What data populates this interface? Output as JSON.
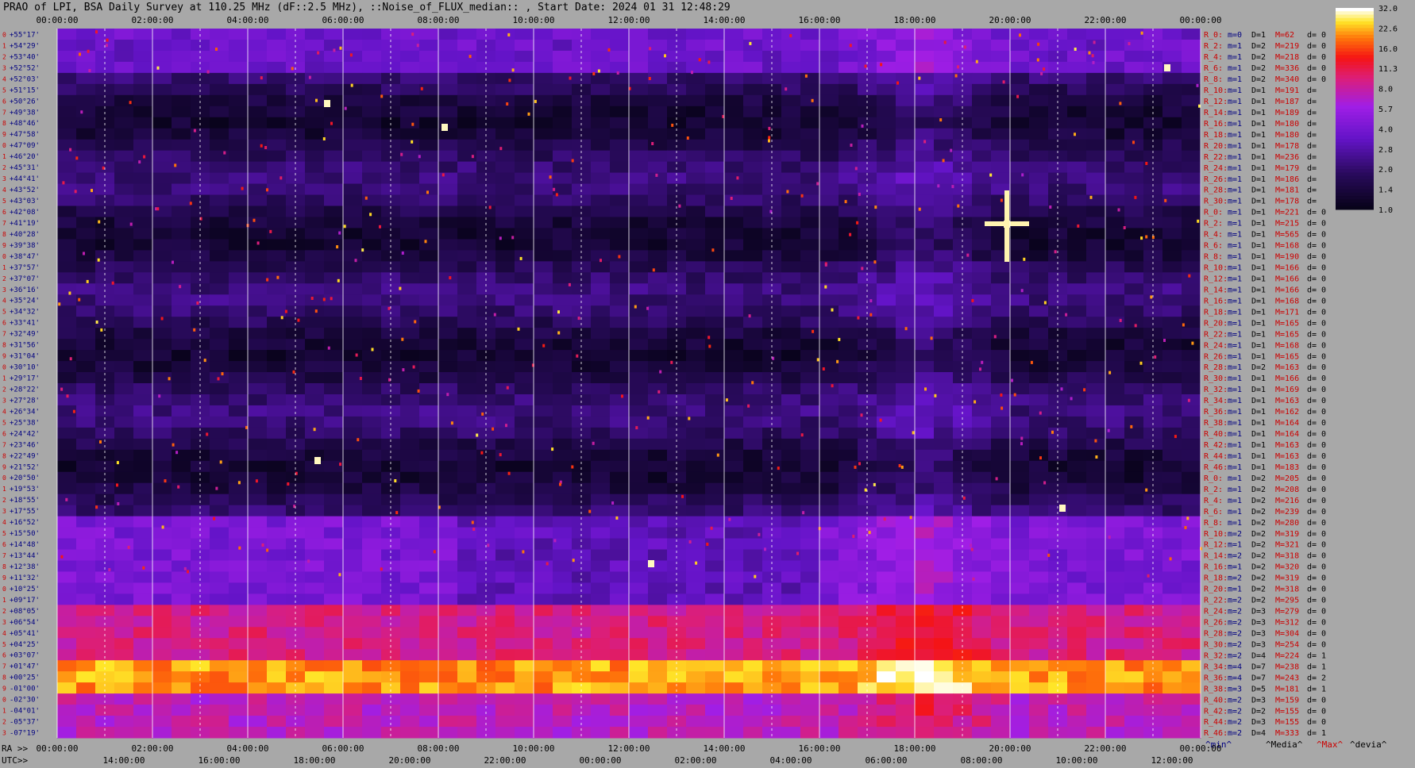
{
  "title": "PRAO of LPI, BSA Daily Survey at 110.25 MHz (dF::2.5 MHz), ::Noise_of_FLUX_median:: , Start Date: 2024 01 31 12:48:29",
  "colors": {
    "background": "#a8a8a8",
    "label_red": "#cc0000",
    "label_blue": "#000080"
  },
  "chart_data": {
    "type": "heatmap",
    "colormap": "black-purple-red-yellow-white",
    "top_axis_labels": [
      "00:00:00",
      "02:00:00",
      "04:00:00",
      "06:00:00",
      "08:00:00",
      "10:00:00",
      "12:00:00",
      "14:00:00",
      "16:00:00",
      "18:00:00",
      "20:00:00",
      "22:00:00",
      "00:00:00"
    ],
    "bottom_ra_prefix": "RA >>",
    "bottom_ra_labels": [
      "00:00:00",
      "02:00:00",
      "04:00:00",
      "06:00:00",
      "08:00:00",
      "10:00:00",
      "12:00:00",
      "14:00:00",
      "16:00:00",
      "18:00:00",
      "20:00:00",
      "22:00:00",
      "00:00:00"
    ],
    "bottom_utc_prefix": "UTC>>",
    "bottom_utc_labels": [
      "14:00:00",
      "16:00:00",
      "18:00:00",
      "20:00:00",
      "22:00:00",
      "00:00:00",
      "02:00:00",
      "04:00:00",
      "06:00:00",
      "08:00:00",
      "10:00:00",
      "12:00:00"
    ],
    "declination_labels": [
      "+55°17'",
      "+54°29'",
      "+53°40'",
      "+52°52'",
      "+52°03'",
      "+51°15'",
      "+50°26'",
      "+49°38'",
      "+48°46'",
      "+47°58'",
      "+47°09'",
      "+46°20'",
      "+45°31'",
      "+44°41'",
      "+43°52'",
      "+43°03'",
      "+42°08'",
      "+41°19'",
      "+40°28'",
      "+39°38'",
      "+38°47'",
      "+37°57'",
      "+37°07'",
      "+36°16'",
      "+35°24'",
      "+34°32'",
      "+33°41'",
      "+32°49'",
      "+31°56'",
      "+31°04'",
      "+30°10'",
      "+29°17'",
      "+28°22'",
      "+27°28'",
      "+26°34'",
      "+25°38'",
      "+24°42'",
      "+23°46'",
      "+22°49'",
      "+21°52'",
      "+20°50'",
      "+19°53'",
      "+18°55'",
      "+17°55'",
      "+16°52'",
      "+15°50'",
      "+14°48'",
      "+13°44'",
      "+12°38'",
      "+11°32'",
      "+10°25'",
      "+09°17'",
      "+08°05'",
      "+06°54'",
      "+05°41'",
      "+04°25'",
      "+03°07'",
      "+01°47'",
      "+00°25'",
      "-01°00'",
      "-02°30'",
      "-04°01'",
      "-05°37'",
      "-07°19'"
    ],
    "colorbar_ticks": [
      "32.0",
      "22.6",
      "16.0",
      "11.3",
      "8.0",
      "5.7",
      "4.0",
      "2.8",
      "2.0",
      "1.4",
      "1.0"
    ],
    "right_stats": [
      {
        "r": "R_0:",
        "m": "m=0",
        "d": "D=1",
        "M": "M=62",
        "dd": "d= 0"
      },
      {
        "r": "R_2:",
        "m": "m=1",
        "d": "D=2",
        "M": "M=219",
        "dd": "d= 0"
      },
      {
        "r": "R_4:",
        "m": "m=1",
        "d": "D=2",
        "M": "M=218",
        "dd": "d= 0"
      },
      {
        "r": "R_6:",
        "m": "m=1",
        "d": "D=2",
        "M": "M=336",
        "dd": "d= 0"
      },
      {
        "r": "R_8:",
        "m": "m=1",
        "d": "D=2",
        "M": "M=340",
        "dd": "d= 0"
      },
      {
        "r": "R_10:",
        "m": "m=1",
        "d": "D=1",
        "M": "M=191",
        "dd": "d="
      },
      {
        "r": "R_12:",
        "m": "m=1",
        "d": "D=1",
        "M": "M=187",
        "dd": "d="
      },
      {
        "r": "R_14:",
        "m": "m=1",
        "d": "D=1",
        "M": "M=189",
        "dd": "d="
      },
      {
        "r": "R_16:",
        "m": "m=1",
        "d": "D=1",
        "M": "M=180",
        "dd": "d="
      },
      {
        "r": "R_18:",
        "m": "m=1",
        "d": "D=1",
        "M": "M=180",
        "dd": "d="
      },
      {
        "r": "R_20:",
        "m": "m=1",
        "d": "D=1",
        "M": "M=178",
        "dd": "d="
      },
      {
        "r": "R_22:",
        "m": "m=1",
        "d": "D=1",
        "M": "M=236",
        "dd": "d="
      },
      {
        "r": "R_24:",
        "m": "m=1",
        "d": "D=1",
        "M": "M=179",
        "dd": "d="
      },
      {
        "r": "R_26:",
        "m": "m=1",
        "d": "D=1",
        "M": "M=186",
        "dd": "d="
      },
      {
        "r": "R_28:",
        "m": "m=1",
        "d": "D=1",
        "M": "M=181",
        "dd": "d="
      },
      {
        "r": "R_30:",
        "m": "m=1",
        "d": "D=1",
        "M": "M=178",
        "dd": "d="
      },
      {
        "r": "R_0:",
        "m": "m=1",
        "d": "D=1",
        "M": "M=221",
        "dd": "d= 0"
      },
      {
        "r": "R_2:",
        "m": "m=1",
        "d": "D=1",
        "M": "M=215",
        "dd": "d= 0"
      },
      {
        "r": "R_4:",
        "m": "m=1",
        "d": "D=1",
        "M": "M=565",
        "dd": "d= 0"
      },
      {
        "r": "R_6:",
        "m": "m=1",
        "d": "D=1",
        "M": "M=168",
        "dd": "d= 0"
      },
      {
        "r": "R_8:",
        "m": "m=1",
        "d": "D=1",
        "M": "M=190",
        "dd": "d= 0"
      },
      {
        "r": "R_10:",
        "m": "m=1",
        "d": "D=1",
        "M": "M=166",
        "dd": "d= 0"
      },
      {
        "r": "R_12:",
        "m": "m=1",
        "d": "D=1",
        "M": "M=166",
        "dd": "d= 0"
      },
      {
        "r": "R_14:",
        "m": "m=1",
        "d": "D=1",
        "M": "M=166",
        "dd": "d= 0"
      },
      {
        "r": "R_16:",
        "m": "m=1",
        "d": "D=1",
        "M": "M=168",
        "dd": "d= 0"
      },
      {
        "r": "R_18:",
        "m": "m=1",
        "d": "D=1",
        "M": "M=171",
        "dd": "d= 0"
      },
      {
        "r": "R_20:",
        "m": "m=1",
        "d": "D=1",
        "M": "M=165",
        "dd": "d= 0"
      },
      {
        "r": "R_22:",
        "m": "m=1",
        "d": "D=1",
        "M": "M=165",
        "dd": "d= 0"
      },
      {
        "r": "R_24:",
        "m": "m=1",
        "d": "D=1",
        "M": "M=168",
        "dd": "d= 0"
      },
      {
        "r": "R_26:",
        "m": "m=1",
        "d": "D=1",
        "M": "M=165",
        "dd": "d= 0"
      },
      {
        "r": "R_28:",
        "m": "m=1",
        "d": "D=2",
        "M": "M=163",
        "dd": "d= 0"
      },
      {
        "r": "R_30:",
        "m": "m=1",
        "d": "D=1",
        "M": "M=166",
        "dd": "d= 0"
      },
      {
        "r": "R_32:",
        "m": "m=1",
        "d": "D=1",
        "M": "M=169",
        "dd": "d= 0"
      },
      {
        "r": "R_34:",
        "m": "m=1",
        "d": "D=1",
        "M": "M=163",
        "dd": "d= 0"
      },
      {
        "r": "R_36:",
        "m": "m=1",
        "d": "D=1",
        "M": "M=162",
        "dd": "d= 0"
      },
      {
        "r": "R_38:",
        "m": "m=1",
        "d": "D=1",
        "M": "M=164",
        "dd": "d= 0"
      },
      {
        "r": "R_40:",
        "m": "m=1",
        "d": "D=1",
        "M": "M=164",
        "dd": "d= 0"
      },
      {
        "r": "R_42:",
        "m": "m=1",
        "d": "D=1",
        "M": "M=163",
        "dd": "d= 0"
      },
      {
        "r": "R_44:",
        "m": "m=1",
        "d": "D=1",
        "M": "M=163",
        "dd": "d= 0"
      },
      {
        "r": "R_46:",
        "m": "m=1",
        "d": "D=1",
        "M": "M=183",
        "dd": "d= 0"
      },
      {
        "r": "R_0:",
        "m": "m=1",
        "d": "D=2",
        "M": "M=205",
        "dd": "d= 0"
      },
      {
        "r": "R_2:",
        "m": "m=1",
        "d": "D=2",
        "M": "M=208",
        "dd": "d= 0"
      },
      {
        "r": "R_4:",
        "m": "m=1",
        "d": "D=2",
        "M": "M=216",
        "dd": "d= 0"
      },
      {
        "r": "R_6:",
        "m": "m=1",
        "d": "D=2",
        "M": "M=239",
        "dd": "d= 0"
      },
      {
        "r": "R_8:",
        "m": "m=1",
        "d": "D=2",
        "M": "M=280",
        "dd": "d= 0"
      },
      {
        "r": "R_10:",
        "m": "m=2",
        "d": "D=2",
        "M": "M=319",
        "dd": "d= 0"
      },
      {
        "r": "R_12:",
        "m": "m=1",
        "d": "D=2",
        "M": "M=321",
        "dd": "d= 0"
      },
      {
        "r": "R_14:",
        "m": "m=2",
        "d": "D=2",
        "M": "M=318",
        "dd": "d= 0"
      },
      {
        "r": "R_16:",
        "m": "m=1",
        "d": "D=2",
        "M": "M=320",
        "dd": "d= 0"
      },
      {
        "r": "R_18:",
        "m": "m=2",
        "d": "D=2",
        "M": "M=319",
        "dd": "d= 0"
      },
      {
        "r": "R_20:",
        "m": "m=1",
        "d": "D=2",
        "M": "M=318",
        "dd": "d= 0"
      },
      {
        "r": "R_22:",
        "m": "m=2",
        "d": "D=2",
        "M": "M=295",
        "dd": "d= 0"
      },
      {
        "r": "R_24:",
        "m": "m=2",
        "d": "D=3",
        "M": "M=279",
        "dd": "d= 0"
      },
      {
        "r": "R_26:",
        "m": "m=2",
        "d": "D=3",
        "M": "M=312",
        "dd": "d= 0"
      },
      {
        "r": "R_28:",
        "m": "m=2",
        "d": "D=3",
        "M": "M=304",
        "dd": "d= 0"
      },
      {
        "r": "R_30:",
        "m": "m=2",
        "d": "D=3",
        "M": "M=254",
        "dd": "d= 0"
      },
      {
        "r": "R_32:",
        "m": "m=2",
        "d": "D=4",
        "M": "M=224",
        "dd": "d= 1"
      },
      {
        "r": "R_34:",
        "m": "m=4",
        "d": "D=7",
        "M": "M=238",
        "dd": "d= 1"
      },
      {
        "r": "R_36:",
        "m": "m=4",
        "d": "D=7",
        "M": "M=243",
        "dd": "d= 2"
      },
      {
        "r": "R_38:",
        "m": "m=3",
        "d": "D=5",
        "M": "M=181",
        "dd": "d= 1"
      },
      {
        "r": "R_40:",
        "m": "m=2",
        "d": "D=3",
        "M": "M=159",
        "dd": "d= 0"
      },
      {
        "r": "R_42:",
        "m": "m=2",
        "d": "D=2",
        "M": "M=155",
        "dd": "d= 0"
      },
      {
        "r": "R_44:",
        "m": "m=2",
        "d": "D=3",
        "M": "M=155",
        "dd": "d= 0"
      },
      {
        "r": "R_46:",
        "m": "m=2",
        "d": "D=4",
        "M": "M=333",
        "dd": "d= 1"
      }
    ],
    "legend_footer": [
      "^min^",
      "^Media^",
      "^Max^",
      "^devia^"
    ]
  }
}
